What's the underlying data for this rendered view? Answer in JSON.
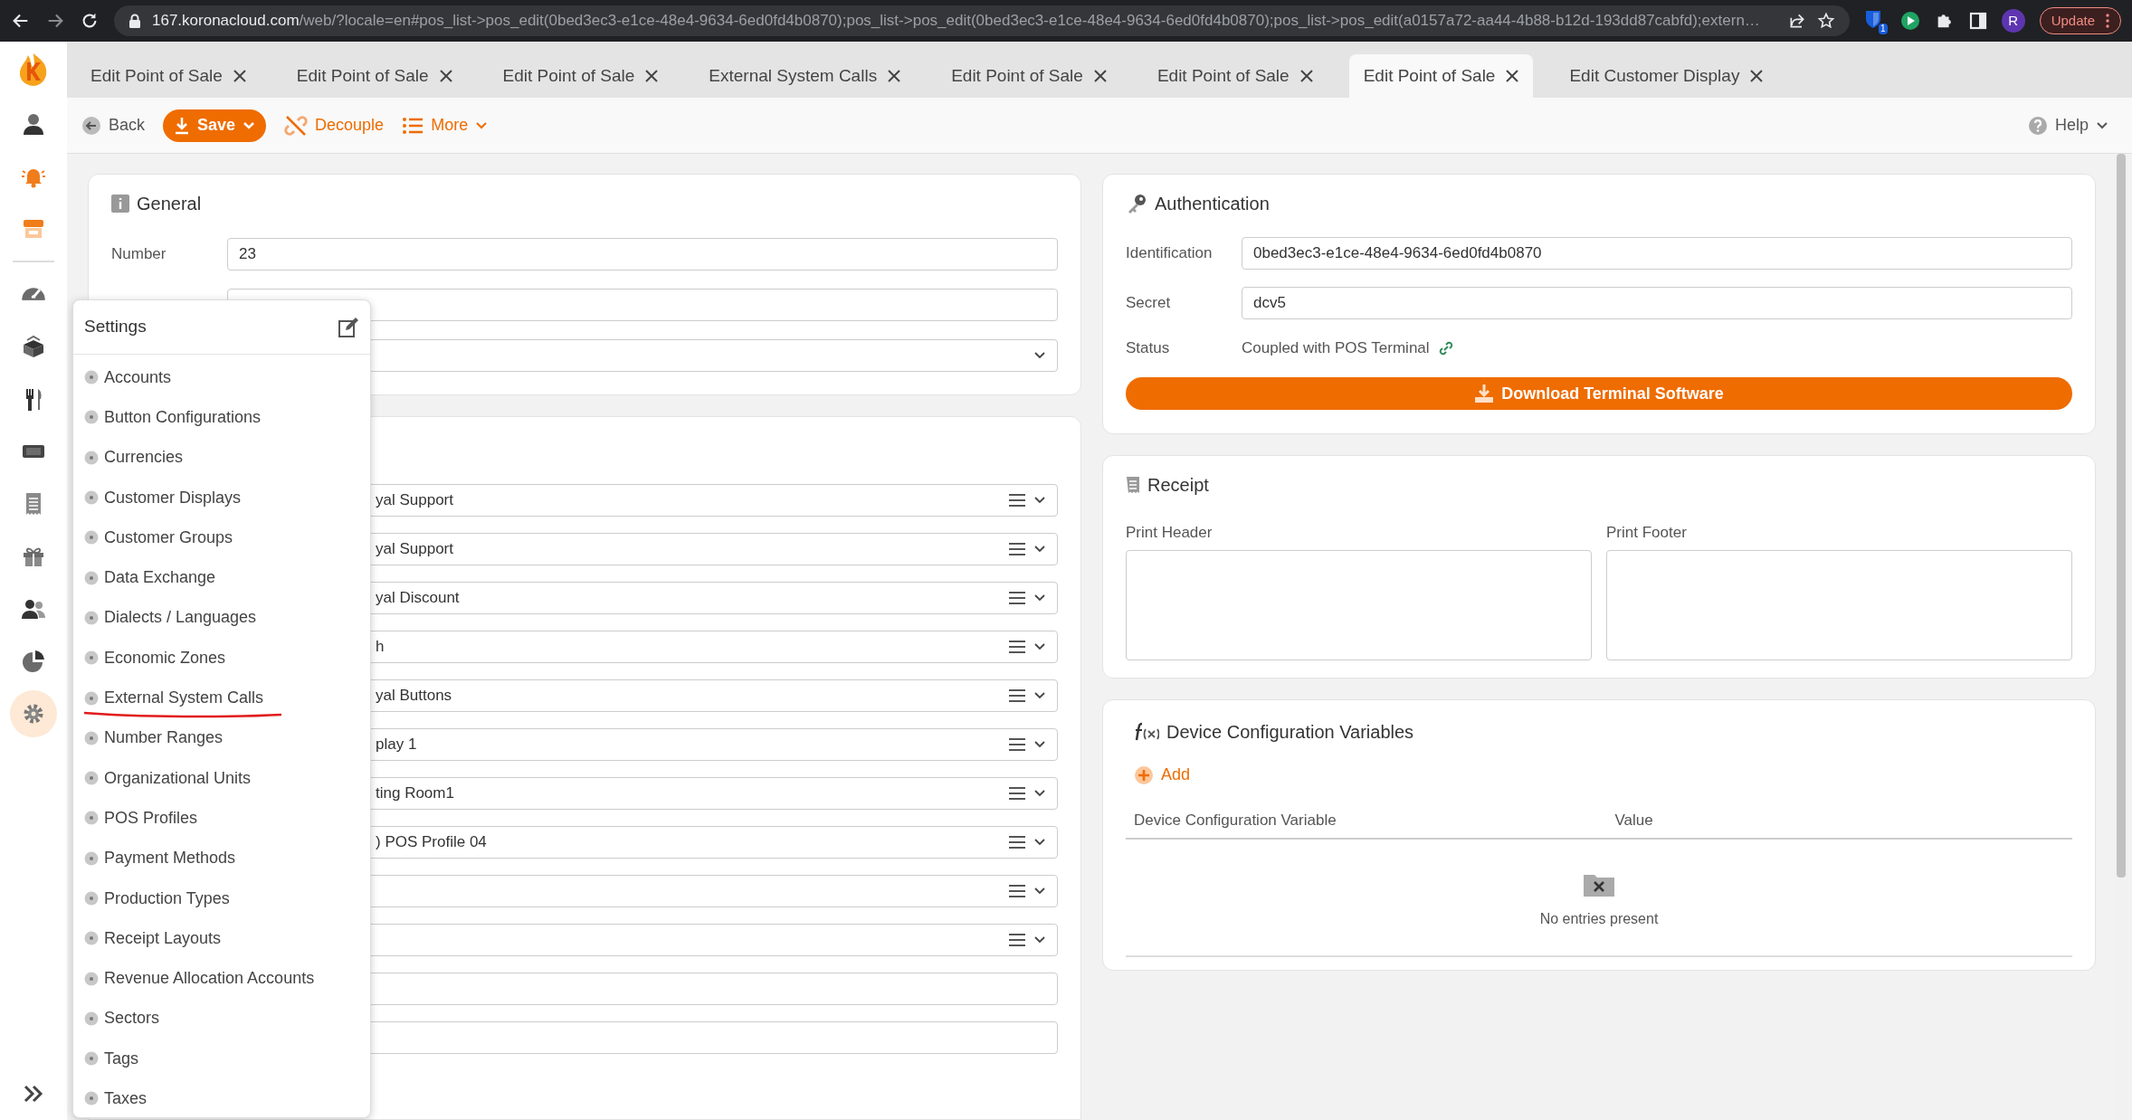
{
  "browser": {
    "url_host": "167.koronacloud.com",
    "url_path": "/web/?locale=en#pos_list->pos_edit(0bed3ec3-e1ce-48e4-9634-6ed0fd4b0870);pos_list->pos_edit(0bed3ec3-e1ce-48e4-9634-6ed0fd4b0870);pos_list->pos_edit(a0157a72-aa44-4b88-b12d-193dd87cabfd);extern…",
    "extension_badge": "1",
    "profile_initial": "R",
    "update_label": "Update"
  },
  "rail": [
    {
      "kind": "user",
      "selected": false
    },
    {
      "kind": "bell",
      "selected": false
    },
    {
      "kind": "store",
      "selected": false
    },
    {
      "kind": "divider"
    },
    {
      "kind": "gauge",
      "selected": false
    },
    {
      "kind": "boxes",
      "selected": false
    },
    {
      "kind": "cutlery",
      "selected": false
    },
    {
      "kind": "ticket",
      "selected": false
    },
    {
      "kind": "receipt",
      "selected": false
    },
    {
      "kind": "gift",
      "selected": false
    },
    {
      "kind": "people",
      "selected": false
    },
    {
      "kind": "pie",
      "selected": false
    },
    {
      "kind": "gear",
      "selected": true
    }
  ],
  "tabs": [
    {
      "label": "Edit Point of Sale",
      "selected": false
    },
    {
      "label": "Edit Point of Sale",
      "selected": false
    },
    {
      "label": "Edit Point of Sale",
      "selected": false
    },
    {
      "label": "External System Calls",
      "selected": false
    },
    {
      "label": "Edit Point of Sale",
      "selected": false
    },
    {
      "label": "Edit Point of Sale",
      "selected": false
    },
    {
      "label": "Edit Point of Sale",
      "selected": true
    },
    {
      "label": "Edit Customer Display",
      "selected": false
    }
  ],
  "toolbar": {
    "back": "Back",
    "save": "Save",
    "decouple": "Decouple",
    "more": "More",
    "help": "Help"
  },
  "general": {
    "title": "General",
    "number_label": "Number",
    "number_value": "23"
  },
  "lookups": [
    {
      "kind": "filled",
      "value": "yal Support"
    },
    {
      "kind": "filled",
      "value": "yal Support"
    },
    {
      "kind": "filled",
      "value": "yal Discount"
    },
    {
      "kind": "filled",
      "value": "h"
    },
    {
      "kind": "filled",
      "value": "yal Buttons"
    },
    {
      "kind": "filled",
      "value": "play 1"
    },
    {
      "kind": "filled",
      "value": "ting Room1"
    },
    {
      "kind": "filled",
      "value": ") POS Profile 04"
    },
    {
      "kind": "blank"
    },
    {
      "kind": "blank"
    }
  ],
  "settings_menu": {
    "title": "Settings",
    "items": [
      {
        "label": "Accounts",
        "underlined": false
      },
      {
        "label": "Button Configurations",
        "underlined": false
      },
      {
        "label": "Currencies",
        "underlined": false
      },
      {
        "label": "Customer Displays",
        "underlined": false
      },
      {
        "label": "Customer Groups",
        "underlined": false
      },
      {
        "label": "Data Exchange",
        "underlined": false
      },
      {
        "label": "Dialects / Languages",
        "underlined": false
      },
      {
        "label": "Economic Zones",
        "underlined": false
      },
      {
        "label": "External System Calls",
        "underlined": true
      },
      {
        "label": "Number Ranges",
        "underlined": false
      },
      {
        "label": "Organizational Units",
        "underlined": false
      },
      {
        "label": "POS Profiles",
        "underlined": false
      },
      {
        "label": "Payment Methods",
        "underlined": false
      },
      {
        "label": "Production Types",
        "underlined": false
      },
      {
        "label": "Receipt Layouts",
        "underlined": false
      },
      {
        "label": "Revenue Allocation Accounts",
        "underlined": false
      },
      {
        "label": "Sectors",
        "underlined": false
      },
      {
        "label": "Tags",
        "underlined": false
      },
      {
        "label": "Taxes",
        "underlined": false
      }
    ]
  },
  "authentication": {
    "title": "Authentication",
    "fields": [
      {
        "label": "Identification",
        "value": "0bed3ec3-e1ce-48e4-9634-6ed0fd4b0870"
      },
      {
        "label": "Secret",
        "value": "dcv5"
      }
    ],
    "status_label": "Status",
    "status_value": "Coupled with POS Terminal",
    "download_button": "Download Terminal Software"
  },
  "receipt": {
    "title": "Receipt",
    "header_label": "Print Header",
    "footer_label": "Print Footer"
  },
  "device_variables": {
    "title": "Device Configuration Variables",
    "add": "Add",
    "columns": [
      "Device Configuration Variable",
      "Value"
    ],
    "empty_message": "No entries present"
  }
}
